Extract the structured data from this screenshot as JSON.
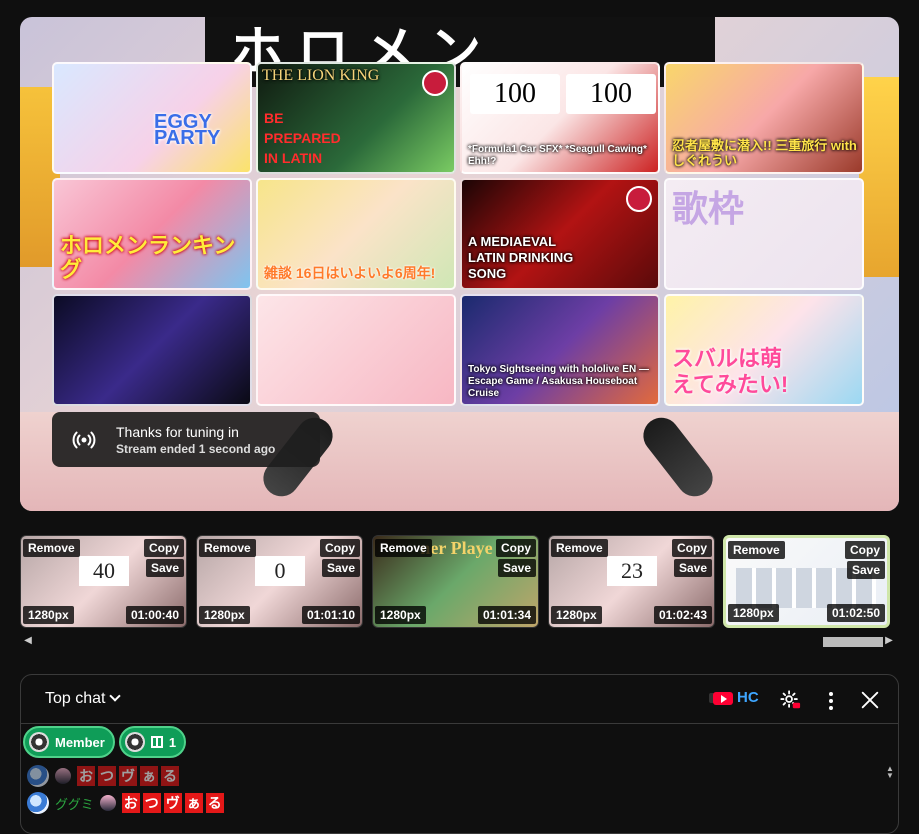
{
  "player": {
    "bg_title": "ホロメン",
    "tiles": [
      {
        "id": "t1",
        "caption": "EGGY PARTY"
      },
      {
        "id": "t2",
        "lion": "THE LION KING",
        "caption": "BE\nPREPARED\nIN LATIN"
      },
      {
        "id": "t3",
        "score_left": "100",
        "score_right": "100",
        "caption": "*Formula1 Car SFX*  *Seagull Cawing*  Ehh!?"
      },
      {
        "id": "t4",
        "caption": "忍者屋敷に潜入!! 三重旅行 with しぐれうい"
      },
      {
        "id": "t5",
        "caption": "ホロメンランキング"
      },
      {
        "id": "t6",
        "caption": "雑談 16日はいよいよ6周年!"
      },
      {
        "id": "t7",
        "caption": "A MEDIAEVAL LATIN DRINKING SONG"
      },
      {
        "id": "t8",
        "caption": "歌枠"
      },
      {
        "id": "t9",
        "caption": ""
      },
      {
        "id": "t10",
        "caption": ""
      },
      {
        "id": "t11",
        "caption": "Tokyo Sightseeing with hololive EN — Escape Game / Asakusa Houseboat Cruise"
      },
      {
        "id": "t12",
        "caption": "スバルは萌えてみたい!"
      }
    ],
    "notice": {
      "title": "Thanks for tuning in",
      "subtitle": "Stream ended 1 second ago"
    }
  },
  "clips": {
    "labels": {
      "remove": "Remove",
      "copy": "Copy",
      "save": "Save"
    },
    "items": [
      {
        "resolution": "1280px",
        "time": "01:00:40",
        "num": "40"
      },
      {
        "resolution": "1280px",
        "time": "01:01:10",
        "num": "0"
      },
      {
        "resolution": "1280px",
        "time": "01:01:34",
        "banner": "ner Playe"
      },
      {
        "resolution": "1280px",
        "time": "01:02:43",
        "num": "23"
      },
      {
        "resolution": "1280px",
        "time": "01:02:50"
      }
    ]
  },
  "chat": {
    "mode_label": "Top chat",
    "hc_label": "HC",
    "chips": {
      "member": "Member",
      "gift_count": "1"
    },
    "messages": [
      {
        "name": "",
        "stamp": [
          "お",
          "つ",
          "ヴ",
          "ぁ",
          "る"
        ],
        "faded": true
      },
      {
        "name": "ググミ",
        "stamp": [
          "お",
          "つ",
          "ヴ",
          "ぁ",
          "る"
        ],
        "faded": false
      }
    ]
  }
}
